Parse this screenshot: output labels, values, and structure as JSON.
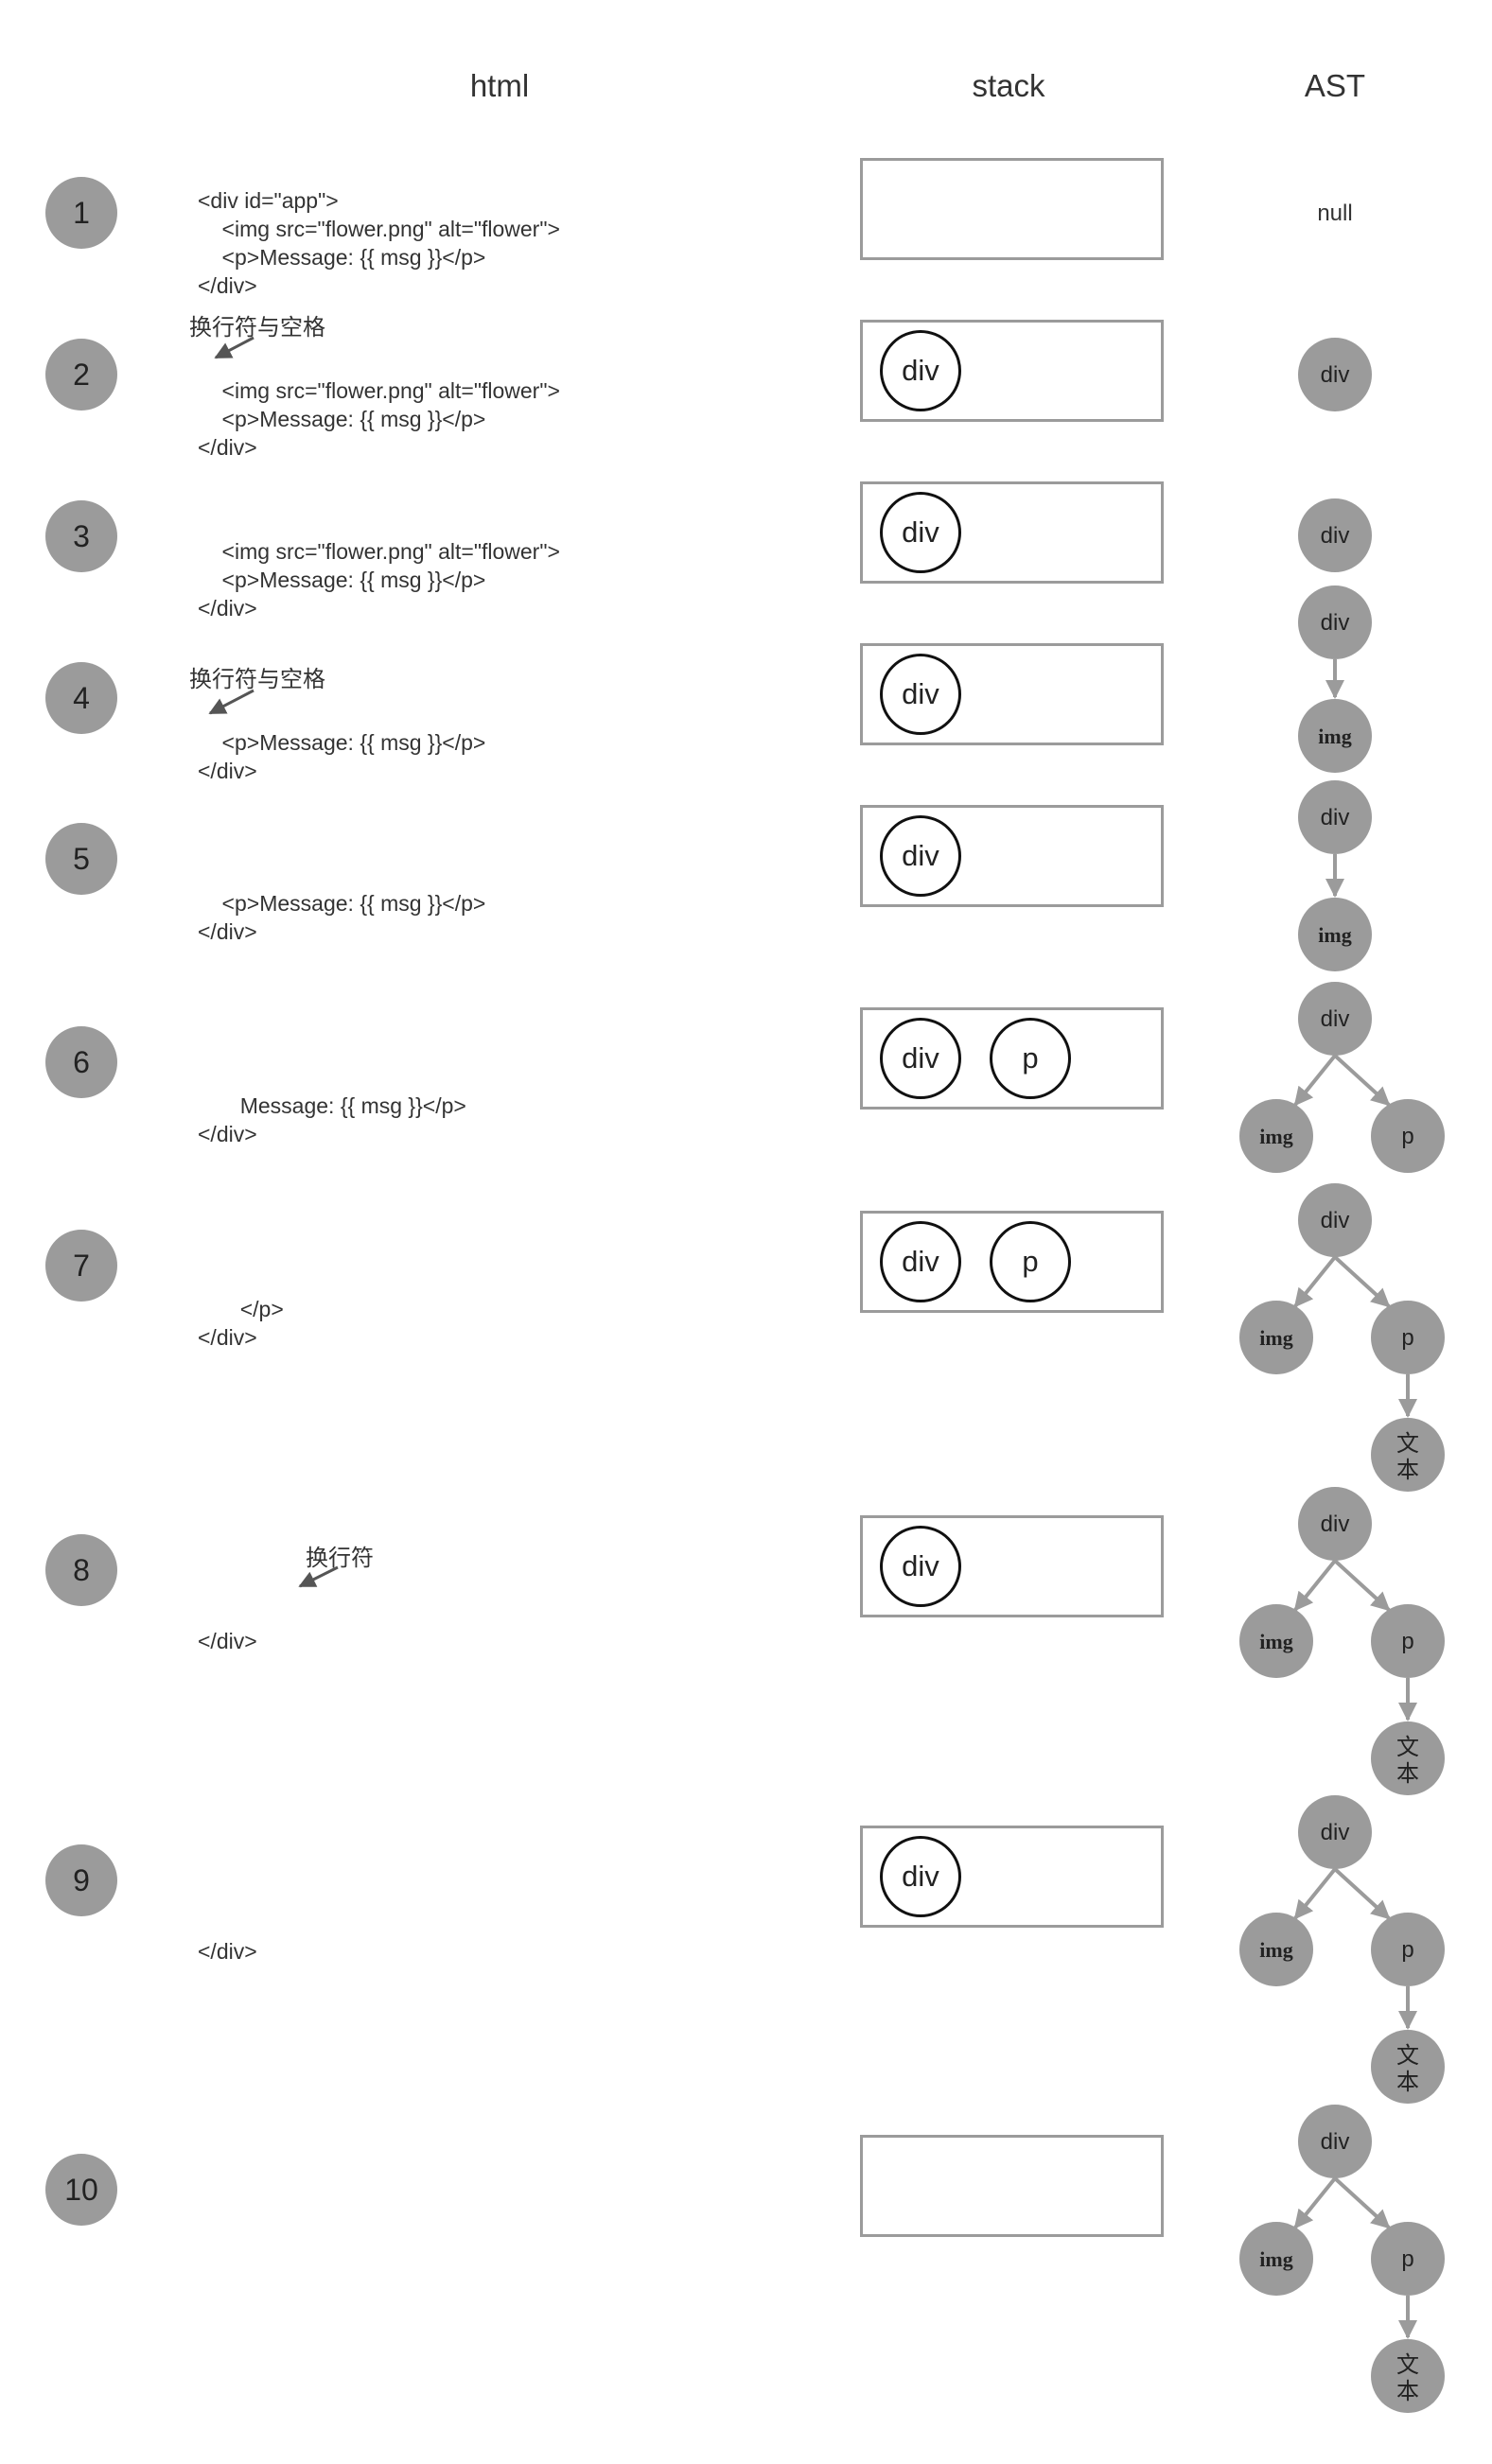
{
  "headers": {
    "html": "html",
    "stack": "stack",
    "ast": "AST"
  },
  "annotations": {
    "ws": "换行符与空格",
    "nl": "换行符"
  },
  "ast_null": "null",
  "steps": [
    {
      "num": "1",
      "code": [
        "<div id=\"app\">",
        "    <img src=\"flower.png\" alt=\"flower\">",
        "    <p>Message: {{ msg }}</p>",
        "</div>"
      ],
      "stack": []
    },
    {
      "num": "2",
      "code": [
        "    <img src=\"flower.png\" alt=\"flower\">",
        "    <p>Message: {{ msg }}</p>",
        "</div>"
      ],
      "stack": [
        "div"
      ]
    },
    {
      "num": "3",
      "code": [
        "    <img src=\"flower.png\" alt=\"flower\">",
        "    <p>Message: {{ msg }}</p>",
        "</div>"
      ],
      "stack": [
        "div"
      ]
    },
    {
      "num": "4",
      "code": [
        "    <p>Message: {{ msg }}</p>",
        "</div>"
      ],
      "stack": [
        "div"
      ]
    },
    {
      "num": "5",
      "code": [
        "    <p>Message: {{ msg }}</p>",
        "</div>"
      ],
      "stack": [
        "div"
      ]
    },
    {
      "num": "6",
      "code": [
        "       Message: {{ msg }}</p>",
        "</div>"
      ],
      "stack": [
        "div",
        "p"
      ]
    },
    {
      "num": "7",
      "code": [
        "       </p>",
        "</div>"
      ],
      "stack": [
        "div",
        "p"
      ]
    },
    {
      "num": "8",
      "code": [
        "</div>"
      ],
      "stack": [
        "div"
      ]
    },
    {
      "num": "9",
      "code": [
        "</div>"
      ],
      "stack": [
        "div"
      ]
    },
    {
      "num": "10",
      "code": [],
      "stack": []
    }
  ],
  "ast_labels": {
    "div": "div",
    "img": "img",
    "p": "p",
    "text_top": "文",
    "text_bottom": "本"
  },
  "colors": {
    "node_fill": "#9b9b9b",
    "edge": "#9b9b9b",
    "box_border": "#9b9b9b",
    "stack_ring": "#111111"
  }
}
